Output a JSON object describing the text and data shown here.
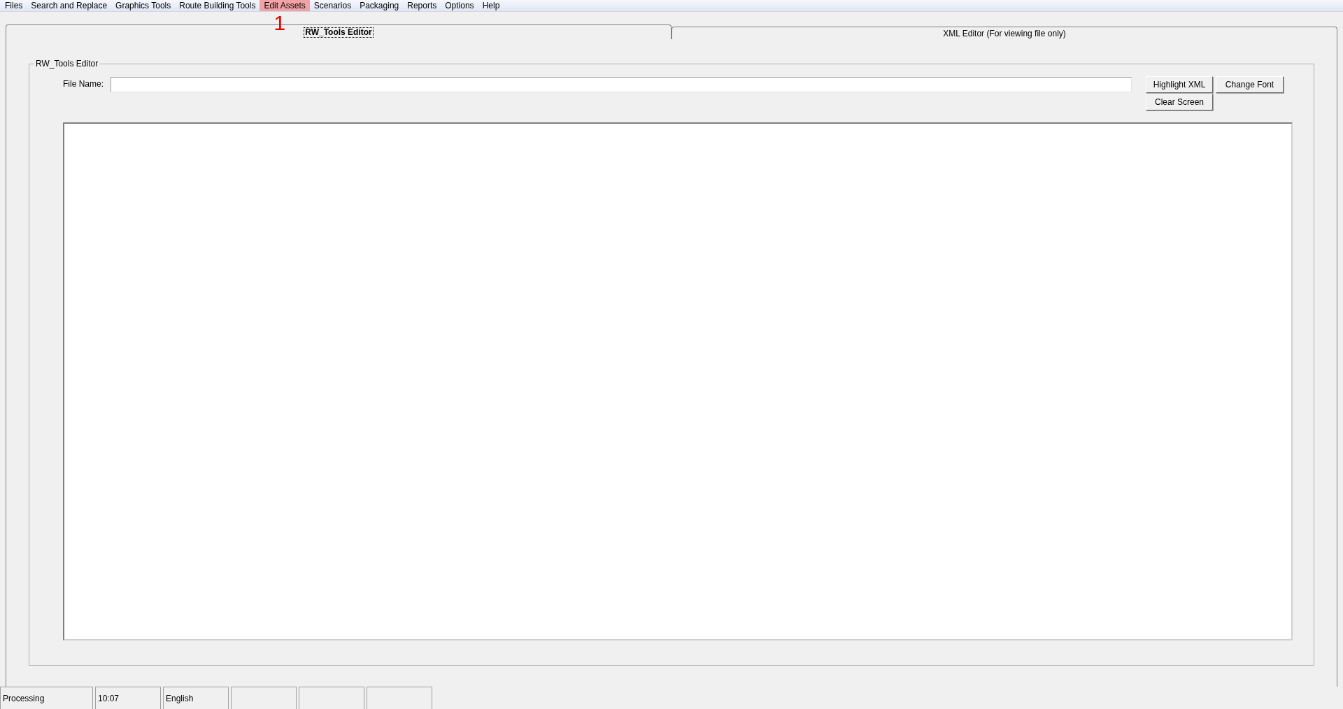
{
  "menu_bar": [
    {
      "label": "Files",
      "highlighted": false
    },
    {
      "label": "Search and Replace",
      "highlighted": false
    },
    {
      "label": "Graphics Tools",
      "highlighted": false
    },
    {
      "label": "Route Building Tools",
      "highlighted": false
    },
    {
      "label": "Edit Assets",
      "highlighted": true
    },
    {
      "label": "Scenarios",
      "highlighted": false
    },
    {
      "label": "Packaging",
      "highlighted": false
    },
    {
      "label": "Reports",
      "highlighted": false
    },
    {
      "label": "Options",
      "highlighted": false
    },
    {
      "label": "Help",
      "highlighted": false
    }
  ],
  "annotation": {
    "label": "1"
  },
  "tabs": [
    {
      "label": "RW_Tools Editor",
      "selected": true
    },
    {
      "label": "XML Editor (For viewing file only)",
      "selected": false
    }
  ],
  "group": {
    "title": "RW_Tools Editor",
    "file_name_label": "File Name:",
    "buttons": [
      "Highlight XML",
      "Clear Screen",
      "Change Font"
    ]
  },
  "status_bar": [
    "Processing",
    "10:07",
    "English"
  ]
}
